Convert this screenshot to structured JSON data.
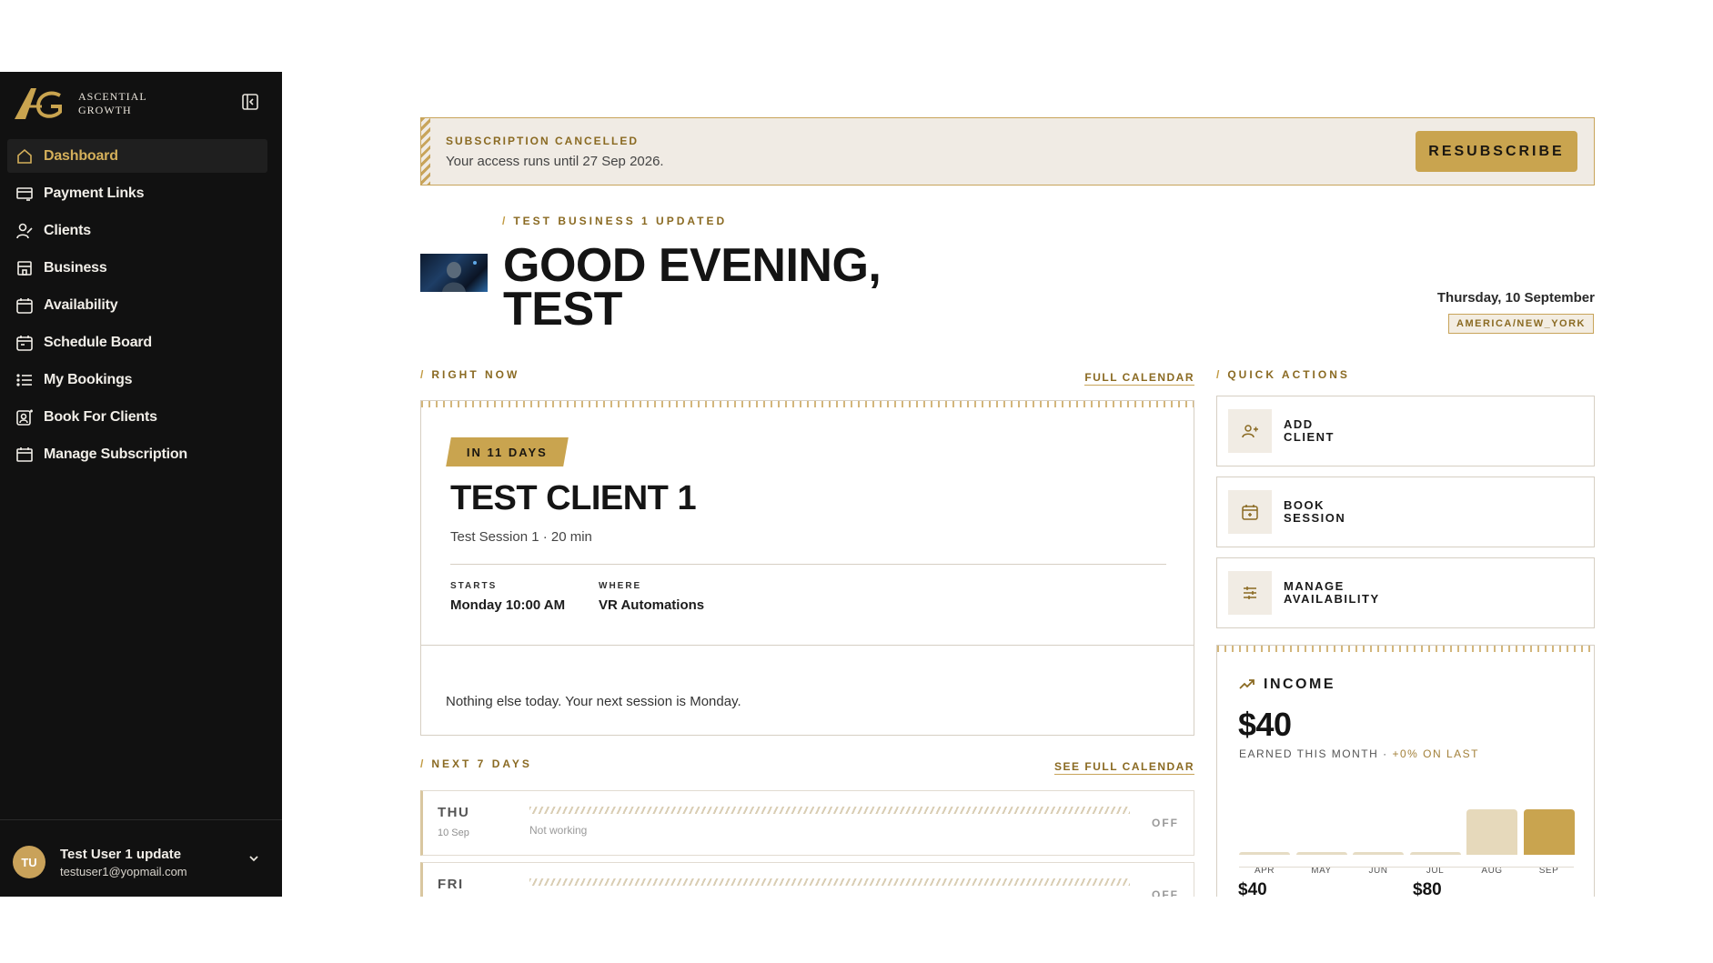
{
  "brand": {
    "line1": "ASCENTIAL",
    "line2": "GROWTH"
  },
  "sidebar": {
    "items": [
      {
        "label": "Dashboard",
        "icon": "home-icon",
        "active": true
      },
      {
        "label": "Payment Links",
        "icon": "payment-link-icon"
      },
      {
        "label": "Clients",
        "icon": "clients-icon"
      },
      {
        "label": "Business",
        "icon": "business-icon"
      },
      {
        "label": "Availability",
        "icon": "calendar-icon"
      },
      {
        "label": "Schedule Board",
        "icon": "schedule-icon"
      },
      {
        "label": "My Bookings",
        "icon": "list-icon"
      },
      {
        "label": "Book For Clients",
        "icon": "book-clients-icon"
      },
      {
        "label": "Manage Subscription",
        "icon": "subscription-icon"
      }
    ]
  },
  "user": {
    "initials": "TU",
    "name": "Test User 1 update",
    "email": "testuser1@yopmail.com"
  },
  "banner": {
    "title": "SUBSCRIPTION CANCELLED",
    "text": "Your access runs until 27 Sep 2026.",
    "button": "RESUBSCRIBE"
  },
  "header": {
    "business_tag": "TEST BUSINESS 1 UPDATED",
    "greeting_line1": "GOOD EVENING,",
    "greeting_line2": "TEST",
    "date": "Thursday, 10 September",
    "timezone": "AMERICA/NEW_YORK"
  },
  "right_now": {
    "label": "RIGHT NOW",
    "link": "FULL CALENDAR",
    "badge": "IN 11 DAYS",
    "client": "TEST CLIENT 1",
    "session": "Test Session 1 · 20 min",
    "starts_label": "STARTS",
    "starts_value": "Monday 10:00 AM",
    "where_label": "WHERE",
    "where_value": "VR Automations",
    "nothing": "Nothing else today. Your next session is Monday."
  },
  "next7": {
    "label": "NEXT 7 DAYS",
    "link": "SEE FULL CALENDAR",
    "days": [
      {
        "day": "THU",
        "date": "10 Sep",
        "status": "Not working",
        "off": "OFF"
      },
      {
        "day": "FRI",
        "date": "",
        "status": "",
        "off": "OFF"
      }
    ]
  },
  "quick_actions": {
    "label": "QUICK ACTIONS",
    "items": [
      {
        "line1": "ADD",
        "line2": "CLIENT",
        "icon": "add-client-icon"
      },
      {
        "line1": "BOOK",
        "line2": "SESSION",
        "icon": "book-session-icon"
      },
      {
        "line1": "MANAGE",
        "line2": "AVAILABILITY",
        "icon": "sliders-icon"
      }
    ]
  },
  "income": {
    "title": "INCOME",
    "amount": "$40",
    "sub": "EARNED THIS MONTH",
    "delta": "+0% ON LAST",
    "stat1": "$40",
    "stat2": "$80",
    "chart_data": {
      "type": "bar",
      "categories": [
        "APR",
        "MAY",
        "JUN",
        "JUL",
        "AUG",
        "SEP"
      ],
      "values": [
        0,
        0,
        0,
        0,
        40,
        40
      ],
      "colors": [
        "#e6dcc4",
        "#e6dcc4",
        "#e6dcc4",
        "#e6dcc4",
        "#e6d9bb",
        "#c9a44f"
      ]
    }
  },
  "colors": {
    "gold": "#c9a44f",
    "gold_text": "#8a6a22",
    "sidebar_bg": "#111111"
  }
}
